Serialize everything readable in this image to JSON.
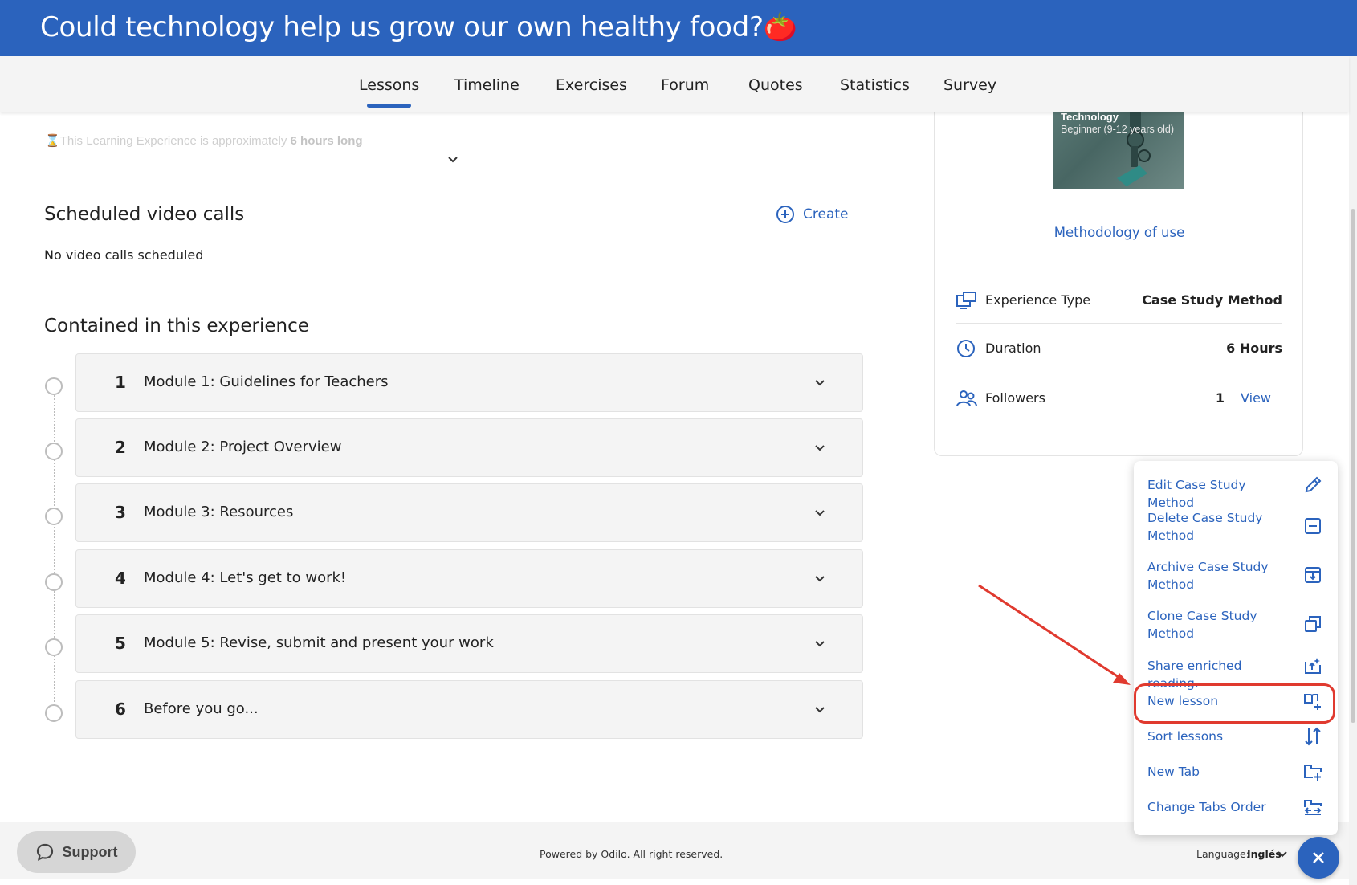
{
  "header": {
    "title": "Could technology help us grow our own healthy food?🍅"
  },
  "tabs": [
    {
      "label": "Lessons",
      "active": true
    },
    {
      "label": "Timeline"
    },
    {
      "label": "Exercises"
    },
    {
      "label": "Forum"
    },
    {
      "label": "Quotes"
    },
    {
      "label": "Statistics"
    },
    {
      "label": "Survey"
    }
  ],
  "intro": {
    "faded_text": "This Learning Experience is approximately",
    "faded_duration": "6 hours long"
  },
  "video_calls": {
    "title": "Scheduled video calls",
    "create_label": "Create",
    "empty_text": "No video calls scheduled"
  },
  "contained": {
    "title": "Contained in this experience",
    "modules": [
      {
        "number": "1",
        "title": "Module 1: Guidelines for Teachers"
      },
      {
        "number": "2",
        "title": "Module 2: Project Overview"
      },
      {
        "number": "3",
        "title": "Module 3: Resources"
      },
      {
        "number": "4",
        "title": "Module 4: Let's get to work!"
      },
      {
        "number": "5",
        "title": "Module 5: Revise, submit and present your work"
      },
      {
        "number": "6",
        "title": "Before you go..."
      }
    ]
  },
  "sidebar": {
    "thumbnail": {
      "category": "Technology",
      "level": "Beginner (9-12 years old)"
    },
    "methodology_link": "Methodology of use",
    "rows": {
      "experience_type": {
        "label": "Experience Type",
        "value": "Case Study Method"
      },
      "duration": {
        "label": "Duration",
        "value": "6 Hours"
      },
      "followers": {
        "label": "Followers",
        "value": "1",
        "link": "View"
      }
    }
  },
  "menu": {
    "items": [
      {
        "label": "Edit Case Study Method",
        "icon": "pencil-icon"
      },
      {
        "label": "Delete Case Study Method",
        "icon": "minus-square-icon"
      },
      {
        "label": "Archive Case Study Method",
        "icon": "archive-icon"
      },
      {
        "label": "Clone Case Study Method",
        "icon": "clone-icon"
      },
      {
        "label": "Share enriched reading.",
        "icon": "share-reading-icon"
      },
      {
        "label": "New lesson",
        "icon": "new-lesson-icon",
        "highlighted": true
      },
      {
        "label": "Sort lessons",
        "icon": "sort-icon"
      },
      {
        "label": "New Tab",
        "icon": "new-tab-icon"
      },
      {
        "label": "Change Tabs Order",
        "icon": "change-tabs-order-icon"
      }
    ]
  },
  "footer": {
    "support_label": "Support",
    "powered_text": "Powered by Odilo. All right reserved.",
    "language_label": "Language:",
    "language_value": "Inglés"
  },
  "colors": {
    "brand": "#2b63bd",
    "highlight": "#e03a2f"
  }
}
